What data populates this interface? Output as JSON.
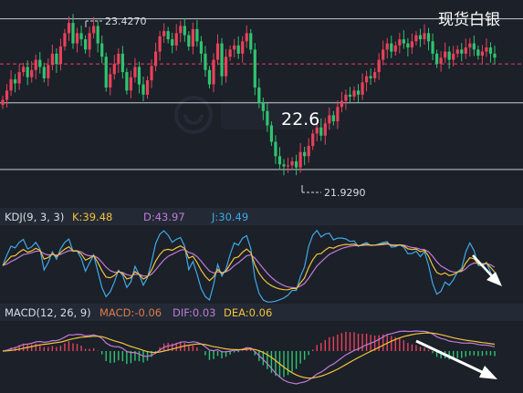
{
  "chart_data": {
    "type": "candlestick",
    "title": "现货白银",
    "center_label": "22.6",
    "price_ylim": [
      21.7,
      23.55
    ],
    "levels": [
      {
        "price": 23.42,
        "label": ""
      },
      {
        "price": 22.98,
        "label": ""
      },
      {
        "price": 22.6,
        "label": ""
      },
      {
        "price": 21.95,
        "label": ""
      }
    ],
    "annotations": {
      "high": {
        "label": "23.4270",
        "value": 23.427
      },
      "low": {
        "label": "21.9290",
        "value": 21.929
      }
    },
    "close_series": [
      22.63,
      22.72,
      22.83,
      22.79,
      22.9,
      22.95,
      22.85,
      22.92,
      23.02,
      22.95,
      22.84,
      22.97,
      23.08,
      22.98,
      23.15,
      23.28,
      23.38,
      23.18,
      23.28,
      23.22,
      23.12,
      23.28,
      23.35,
      23.18,
      23.05,
      22.75,
      22.88,
      22.98,
      23.08,
      22.9,
      22.72,
      22.85,
      22.95,
      22.78,
      22.68,
      22.82,
      22.96,
      23.1,
      23.25,
      23.3,
      23.22,
      23.16,
      23.28,
      23.35,
      23.26,
      23.15,
      23.32,
      23.2,
      23.08,
      22.92,
      22.78,
      23.02,
      23.18,
      22.86,
      23.05,
      23.12,
      23.16,
      23.08,
      23.2,
      23.28,
      23.12,
      22.75,
      22.6,
      22.52,
      22.38,
      22.22,
      22.08,
      22.0,
      21.98,
      21.99,
      22.03,
      21.97,
      22.12,
      22.08,
      22.18,
      22.3,
      22.36,
      22.28,
      22.4,
      22.48,
      22.42,
      22.56,
      22.62,
      22.68,
      22.66,
      22.72,
      22.68,
      22.8,
      22.86,
      22.84,
      22.9,
      23.02,
      23.12,
      23.18,
      23.1,
      23.16,
      23.22,
      23.18,
      23.14,
      23.2,
      23.26,
      23.22,
      23.28,
      23.2,
      23.08,
      22.98,
      23.04,
      23.1,
      23.02,
      23.08,
      23.12,
      23.08,
      23.14,
      23.18,
      23.12,
      23.06,
      23.1,
      23.14,
      23.08,
      23.04
    ],
    "indicators": {
      "kdj": {
        "title": "KDJ(9, 3, 3)",
        "K": {
          "label": "K:39.48",
          "color": "#f2c23b"
        },
        "D": {
          "label": "D:43.97",
          "color": "#c27ad9"
        },
        "J": {
          "label": "J:30.49",
          "color": "#3ea9e8"
        }
      },
      "macd": {
        "title": "MACD(12, 26, 9)",
        "MACD": {
          "label": "MACD:-0.06",
          "color": "#e07a4a"
        },
        "DIF": {
          "label": "DIF:0.03",
          "color": "#c27ad9"
        },
        "DEA": {
          "label": "DEA:0.06",
          "color": "#f2c23b"
        }
      }
    },
    "colors": {
      "up": "#e8415a",
      "down": "#2fc46f",
      "background": "#1b2029",
      "level_line": "#c8ccd4",
      "dashed_level": "#e8415a",
      "header_bg": "#232a35",
      "arrow": "#ffffff",
      "text": "#d9dde4",
      "watermark": "#3a4250"
    }
  }
}
